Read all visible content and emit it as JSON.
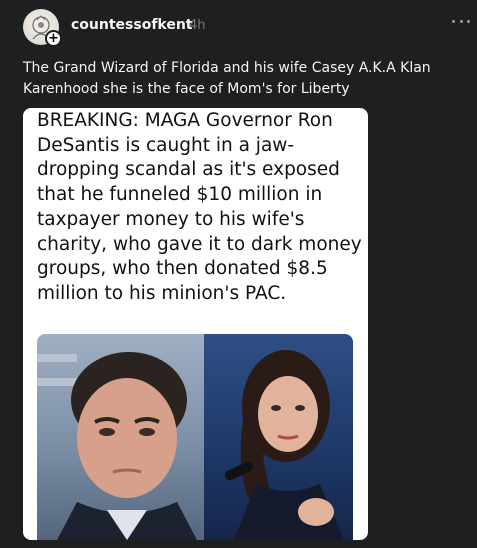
{
  "post": {
    "username": "countessofkent",
    "timestamp": "4h",
    "caption": "The Grand Wizard of Florida and his wife Casey A.K.A Klan Karenhood she is the face of Mom's for Liberty",
    "follow_symbol": "+",
    "icons": [
      "avatar-icon",
      "follow-plus-icon",
      "more-options-icon"
    ]
  },
  "image": {
    "headline": "BREAKING: MAGA Governor Ron DeSantis is caught in a jaw-dropping scandal as it's exposed that he funneled $10 million in taxpayer money to his wife's charity, who gave it to dark money groups, who then donated $8.5 million to his minion's PAC."
  },
  "colors": {
    "background": "#1e1f21",
    "text": "#f3f5f7",
    "muted": "#777777",
    "card": "#ffffff"
  }
}
